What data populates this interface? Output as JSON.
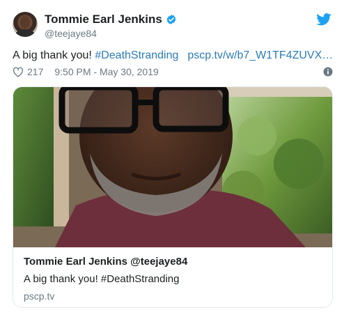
{
  "author": {
    "name": "Tommie Earl Jenkins",
    "handle": "@teejaye84"
  },
  "tweet": {
    "text": "A big thank you!",
    "hashtag": "#DeathStranding",
    "link": "pscp.tv/w/b7_W1TF4ZUVX…"
  },
  "meta": {
    "likes": "217",
    "timestamp": "9:50 PM - May 30, 2019"
  },
  "card": {
    "title": "Tommie Earl Jenkins @teejaye84",
    "description": "A big thank you! #DeathStranding",
    "domain": "pscp.tv"
  },
  "colors": {
    "link": "#2b7bb9",
    "twitter_blue": "#1da1f2",
    "muted": "#697882"
  },
  "icons": [
    "verified-icon",
    "twitter-logo-icon",
    "heart-icon",
    "info-icon"
  ]
}
